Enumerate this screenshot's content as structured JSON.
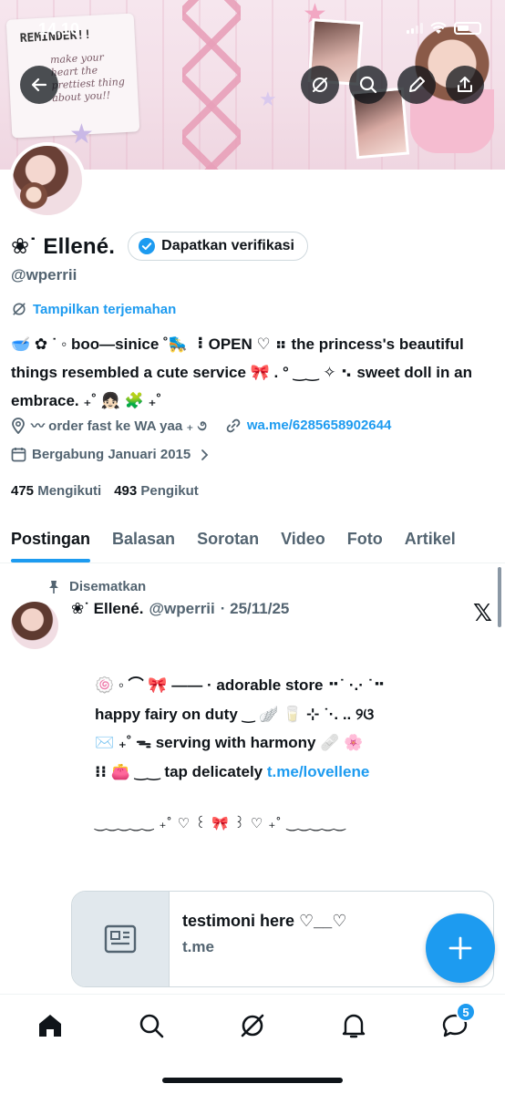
{
  "status_bar": {
    "time": "14.10"
  },
  "banner": {
    "note_title": "REMINDER!!",
    "note_body": "make your heart the prettiest thing about you!!",
    "accent_pink": "#f2a7c3"
  },
  "header_buttons": [
    "back-icon",
    "grok-icon",
    "search-icon",
    "edit-icon",
    "share-icon"
  ],
  "profile": {
    "name": "❀˙ Ellené.",
    "verify_label": "Dapatkan verifikasi",
    "handle": "@wperrii",
    "translate_label": "Tampilkan terjemahan",
    "bio": "🥣 ✿ ˙ ◦ boo—sinice ˚🛼 ⠸ OPEN ♡ ⠶ the princess's beautiful things resembled a cute service 🎀 . ° ‿‿ ✧ ⠢ sweet doll in an embrace. ₊˚ 👧🏻 🧩 ₊˚",
    "location": "〰 order fast ke WA yaa ₊ ૭",
    "website": "wa.me/6285658902644",
    "joined": "Bergabung Januari 2015",
    "following_count": "475",
    "following_label": "Mengikuti",
    "followers_count": "493",
    "followers_label": "Pengikut"
  },
  "tabs": [
    "Postingan",
    "Balasan",
    "Sorotan",
    "Video",
    "Foto",
    "Artikel"
  ],
  "post": {
    "pinned_label": "Disematkan",
    "author_name": "❀˙ Ellené.",
    "author_handle": "@wperrii",
    "date": "· 25/11/25",
    "line1": "🍥 ◦ ⌒ 🎀 —— · adorable store ⠒˙ ·.· ˙⠒",
    "line2": "happy fairy on duty ‿ 🪽 🥛 ⊹ ˙·. .. ୨ଓ",
    "line3": "✉️ ₊˚ ᯓ serving with harmony 🩹 🌸",
    "line4_text": "⁝⁝ 👛 ‿‿ tap delicately",
    "line4_link": "t.me/lovellene",
    "divider": "‿‿‿‿‿ ₊˚ ♡ ꒰ 🎀 ꒱ ♡ ₊˚ ‿‿‿‿‿",
    "card_title": "testimoni here ♡__♡",
    "card_domain": "t.me"
  },
  "bottom_nav": {
    "items": [
      "home-icon",
      "search-icon",
      "grok-icon",
      "notifications-icon",
      "messages-icon"
    ],
    "messages_badge": "5"
  },
  "colors": {
    "accent": "#1d9bf0",
    "text": "#0f1419",
    "muted": "#536471"
  }
}
